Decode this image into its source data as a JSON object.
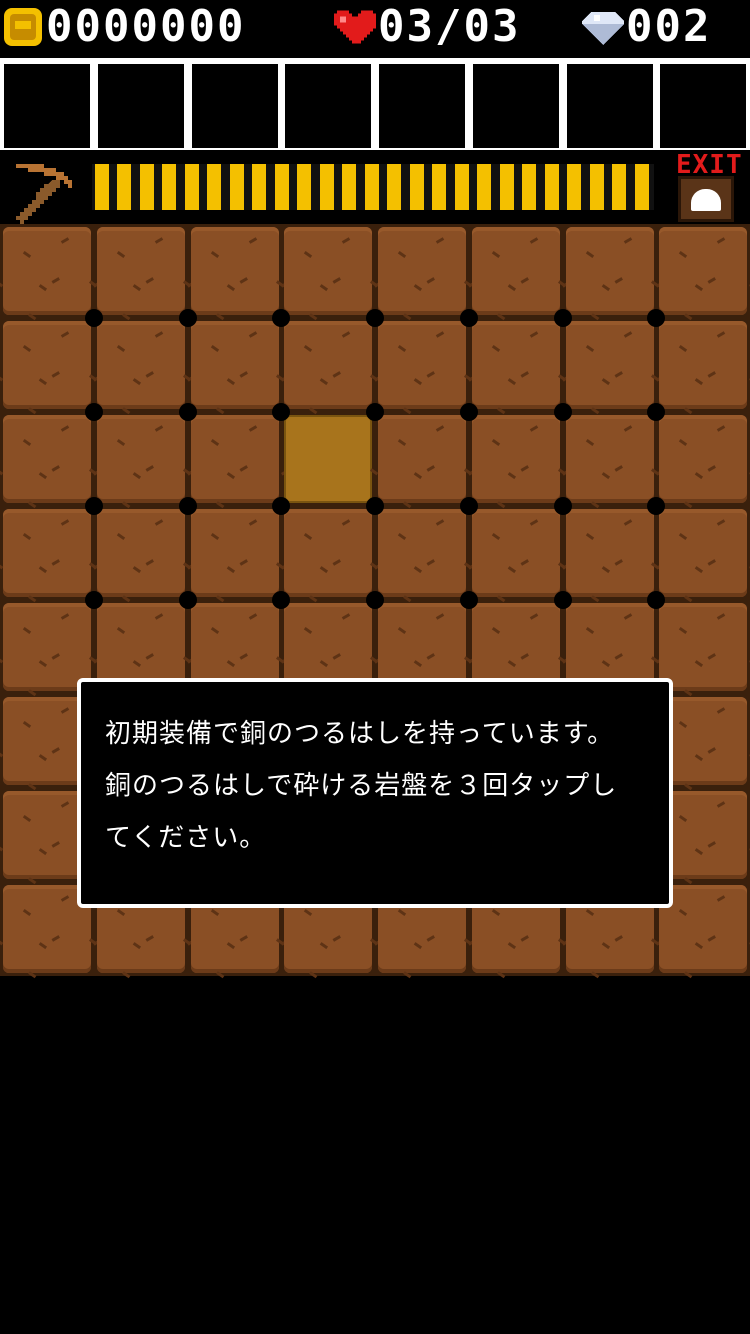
{
  "hud": {
    "gold": "0000000",
    "life": "03/03",
    "gems": "002",
    "gold_icon": "coin-icon",
    "life_icon": "heart-icon",
    "gem_icon": "diamond-icon"
  },
  "inventory": {
    "slot_count": 8
  },
  "tool": {
    "icon": "pickaxe-icon",
    "durability_segments": 25,
    "durability_filled": 25
  },
  "exit": {
    "label": "EXIT",
    "icon": "exit-door-icon"
  },
  "grid": {
    "columns": 8,
    "rows": 8,
    "highlight": {
      "col": 3,
      "row": 2
    }
  },
  "dialog": {
    "lines": [
      "初期装備で銅のつるはしを持っています。",
      "銅のつるはしで砕ける岩盤を３回タップし",
      "てください。"
    ]
  },
  "colors": {
    "gold": "#f4c000",
    "heart": "#e21b1b",
    "dirt": "#8a4f25",
    "highlight": "#a8741c"
  }
}
